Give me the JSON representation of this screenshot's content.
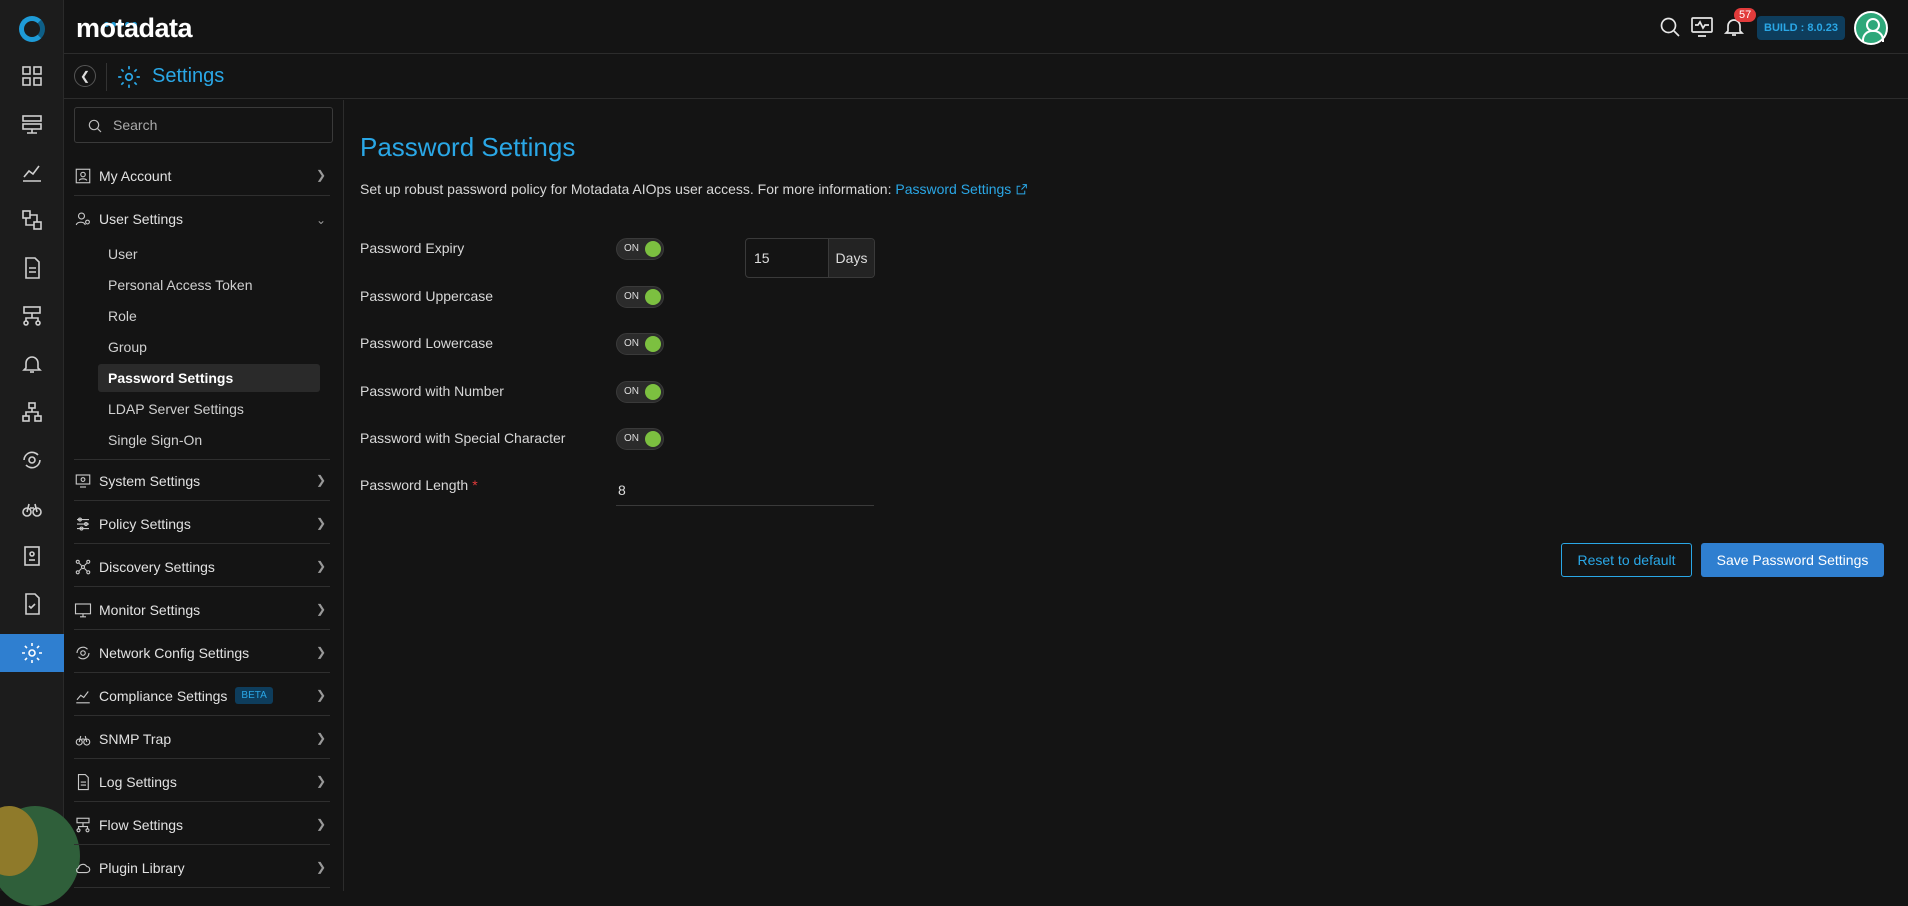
{
  "brand": {
    "name": "motadata"
  },
  "topbar": {
    "notification_count": "57",
    "build": "BUILD : 8.0.23"
  },
  "subheader": {
    "title": "Settings"
  },
  "sidebar": {
    "search_placeholder": "Search",
    "sections": [
      {
        "label": "My Account",
        "icon": "user-card-icon"
      },
      {
        "label": "User Settings",
        "icon": "user-gear-icon",
        "expanded": true
      },
      {
        "label": "System Settings",
        "icon": "system-settings-icon"
      },
      {
        "label": "Policy Settings",
        "icon": "sliders-icon"
      },
      {
        "label": "Discovery Settings",
        "icon": "network-nodes-icon"
      },
      {
        "label": "Monitor Settings",
        "icon": "monitor-icon"
      },
      {
        "label": "Network Config Settings",
        "icon": "network-config-icon"
      },
      {
        "label": "Compliance Settings",
        "icon": "compliance-icon",
        "badge": "BETA"
      },
      {
        "label": "SNMP Trap",
        "icon": "binoculars-icon"
      },
      {
        "label": "Log Settings",
        "icon": "document-icon"
      },
      {
        "label": "Flow Settings",
        "icon": "flow-icon"
      },
      {
        "label": "Plugin Library",
        "icon": "plugin-icon"
      }
    ],
    "user_settings_items": [
      "User",
      "Personal Access Token",
      "Role",
      "Group",
      "Password Settings",
      "LDAP Server Settings",
      "Single Sign-On"
    ],
    "active_item": "Password Settings"
  },
  "main": {
    "title": "Password Settings",
    "description": "Set up robust password policy for Motadata AIOps user access. For more information:",
    "link_text": "Password Settings",
    "toggle_on_text": "ON",
    "rows": [
      {
        "label": "Password Expiry",
        "state": "ON"
      },
      {
        "label": "Password Uppercase",
        "state": "ON"
      },
      {
        "label": "Password Lowercase",
        "state": "ON"
      },
      {
        "label": "Password with Number",
        "state": "ON"
      },
      {
        "label": "Password with Special Character",
        "state": "ON"
      }
    ],
    "expiry_value": "15",
    "expiry_unit": "Days",
    "length_label": "Password Length",
    "length_required_mark": "*",
    "length_value": "8",
    "reset_button": "Reset to default",
    "save_button": "Save Password Settings"
  },
  "colors": {
    "accent": "#2aa7e6",
    "primary_button": "#2f7fd0",
    "toggle_on": "#7cc040",
    "badge": "#e23b3b"
  }
}
